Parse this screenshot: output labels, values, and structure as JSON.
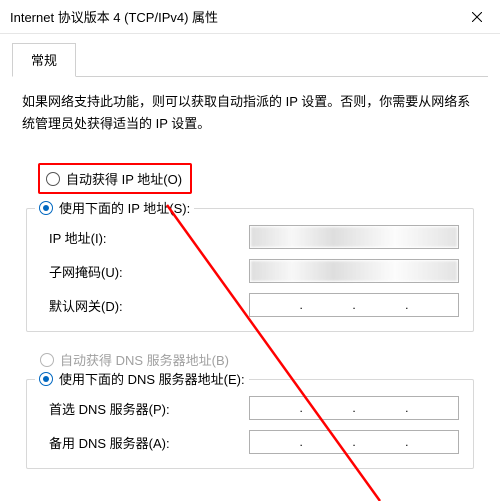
{
  "window": {
    "title": "Internet 协议版本 4 (TCP/IPv4) 属性"
  },
  "tabs": {
    "general": "常规"
  },
  "description": "如果网络支持此功能，则可以获取自动指派的 IP 设置。否则，你需要从网络系统管理员处获得适当的 IP 设置。",
  "ip_section": {
    "auto_label": "自动获得 IP 地址(O)",
    "manual_label": "使用下面的 IP 地址(S):",
    "fields": {
      "ip_label": "IP 地址(I):",
      "subnet_label": "子网掩码(U):",
      "gateway_label": "默认网关(D):"
    }
  },
  "dns_section": {
    "auto_label": "自动获得 DNS 服务器地址(B)",
    "manual_label": "使用下面的 DNS 服务器地址(E):",
    "fields": {
      "preferred_label": "首选 DNS 服务器(P):",
      "alternate_label": "备用 DNS 服务器(A):"
    }
  },
  "annotation": {
    "color": "#ff0000"
  }
}
